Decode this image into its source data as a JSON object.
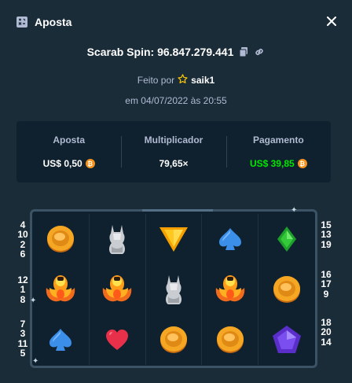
{
  "header": {
    "title": "Aposta",
    "title_icon": "bet-slip-icon",
    "close_icon": "close-icon"
  },
  "bet": {
    "label": "Scarab Spin: 96.847.279.441",
    "copy_icon": "copy-icon",
    "link_icon": "link-icon",
    "placed_by_prefix": "Feito por",
    "user": "saik1",
    "user_icon": "star-icon",
    "date": "em 04/07/2022 às 20:55"
  },
  "stats": [
    {
      "label": "Aposta",
      "value": "US$ 0,50",
      "coin": true,
      "color": "#ffffff"
    },
    {
      "label": "Multiplicador",
      "value": "79,65×",
      "coin": false,
      "color": "#ffffff"
    },
    {
      "label": "Pagamento",
      "value": "US$ 39,85",
      "coin": true,
      "color": "#00e701"
    }
  ],
  "coin_symbol": "₿",
  "paylines": {
    "left": [
      [
        "4",
        "10",
        "2",
        "6"
      ],
      [
        "12",
        "1",
        "8"
      ],
      [
        "7",
        "3",
        "11",
        "5"
      ]
    ],
    "right": [
      [
        "15",
        "13",
        "19"
      ],
      [
        "16",
        "17",
        "9"
      ],
      [
        "18",
        "20",
        "14"
      ]
    ]
  },
  "reels": [
    [
      "coin",
      "scarab",
      "spade"
    ],
    [
      "cat",
      "scarab",
      "heart"
    ],
    [
      "triangle",
      "cat",
      "coin"
    ],
    [
      "spade",
      "scarab",
      "coin"
    ],
    [
      "diamond",
      "coin",
      "pentagon"
    ]
  ]
}
